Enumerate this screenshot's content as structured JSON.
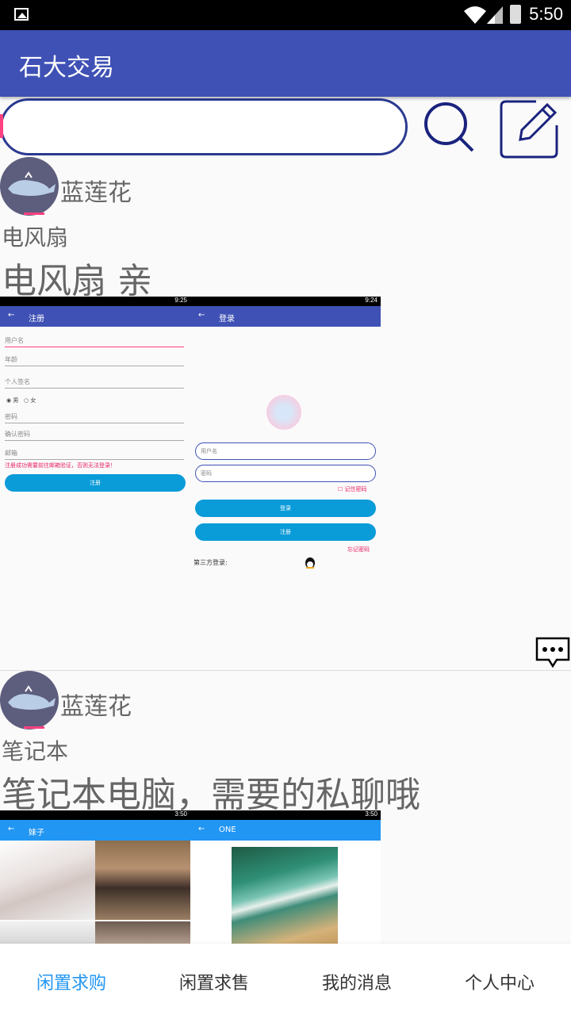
{
  "status_bar": {
    "time": "5:50"
  },
  "app_bar": {
    "title": "石大交易"
  },
  "search": {
    "placeholder": "",
    "value": ""
  },
  "posts": [
    {
      "username": "蓝莲花",
      "title": "电风扇",
      "description": "电风扇 亲",
      "screenshot": {
        "left": {
          "time": "9:25",
          "bar_title": "注册",
          "fields": [
            "用户名",
            "年龄",
            "个人签名",
            "密码",
            "确认密码",
            "邮箱"
          ],
          "gender_male": "男",
          "gender_female": "女",
          "notice": "注册成功需要前往邮箱验证，否则无法登录！",
          "button": "注册"
        },
        "right": {
          "time": "9:24",
          "bar_title": "登录",
          "username_ph": "用户名",
          "password_ph": "密码",
          "remember": "记住密码",
          "login_btn": "登录",
          "register_btn": "注册",
          "forgot": "忘记密码",
          "third_party": "第三方登录:"
        }
      }
    },
    {
      "username": "蓝莲花",
      "title": "笔记本",
      "description": "笔记本电脑，需要的私聊哦",
      "screenshot": {
        "left": {
          "time": "3:50",
          "bar_title": "妹子"
        },
        "right": {
          "time": "3:50",
          "bar_title": "ONE"
        }
      }
    }
  ],
  "bottom_nav": {
    "tabs": [
      "闲置求购",
      "闲置求售",
      "我的消息",
      "个人中心"
    ],
    "active_index": 0
  },
  "colors": {
    "primary": "#3f51b5",
    "accent": "#ff4081",
    "active_tab": "#2196f3"
  }
}
